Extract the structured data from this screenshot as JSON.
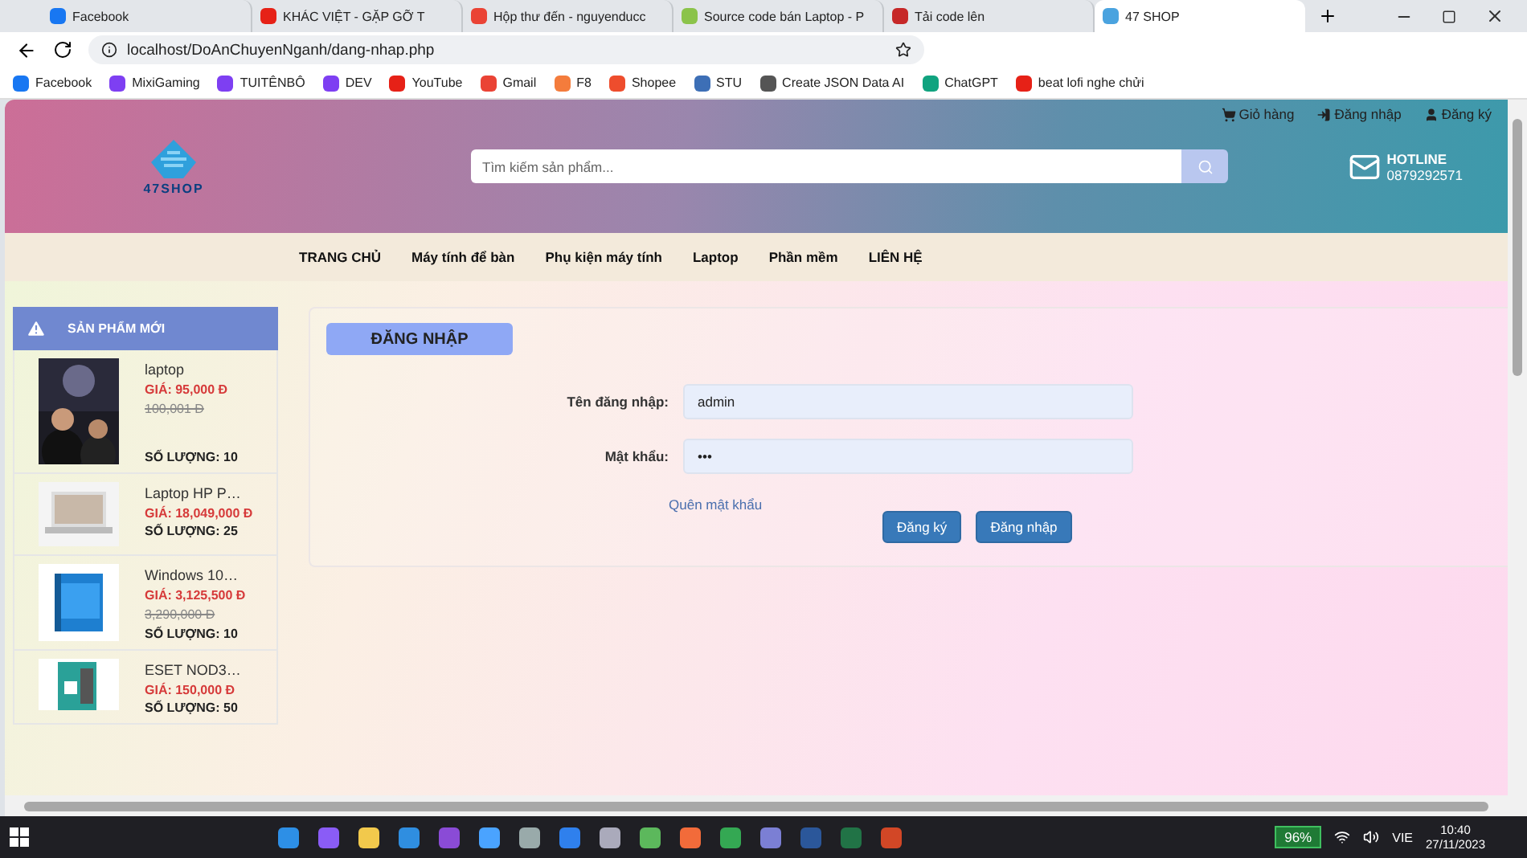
{
  "browser": {
    "tabs": [
      {
        "title": "Facebook",
        "selected": false
      },
      {
        "title": "KHÁC VIỆT - GẶP GỠ T",
        "selected": false
      },
      {
        "title": "Hộp thư đến - nguyenducc",
        "selected": false
      },
      {
        "title": "Source code bán Laptop - P",
        "selected": false
      },
      {
        "title": "Tải code lên",
        "selected": false
      },
      {
        "title": "47 SHOP",
        "selected": true
      }
    ],
    "address": "localhost/DoAnChuyenNganh/dang-nhap.php",
    "bookmarks": [
      "Facebook",
      "MixiGaming",
      "TUITÊNBÔ",
      "DEV",
      "YouTube",
      "Gmail",
      "F8",
      "Shopee",
      "STU",
      "Create JSON Data AI",
      "ChatGPT",
      "beat lofi nghe chửi"
    ]
  },
  "header": {
    "top_links": [
      "Giỏ hàng",
      "Đăng nhập",
      "Đăng ký"
    ],
    "logo": "47SHOP",
    "search": {
      "placeholder": "Tìm kiếm sản phẩm..."
    },
    "hotline_label": "HOTLINE",
    "hotline": "0879292571"
  },
  "nav": [
    "TRANG CHỦ",
    "Máy tính để bàn",
    "Phụ kiện máy tính",
    "Laptop",
    "Phần mềm",
    "LIÊN HỆ"
  ],
  "sidebar": {
    "title": "SẢN PHẨM MỚI",
    "products": [
      {
        "name": "laptop",
        "price": "GIÁ: 95,000 Đ",
        "old_price": "100,001 Đ",
        "quantity": "SỐ LƯỢNG: 10"
      },
      {
        "name": "Laptop HP P…",
        "price": "GIÁ: 18,049,000 Đ",
        "quantity": "SỐ LƯỢNG: 25"
      },
      {
        "name": "Windows 10…",
        "price": "GIÁ: 3,125,500 Đ",
        "old_price": "3,290,000 Đ",
        "quantity": "SỐ LƯỢNG: 10"
      },
      {
        "name": "ESET NOD3…",
        "price": "GIÁ: 150,000 Đ",
        "quantity": "SỐ LƯỢNG: 50"
      }
    ]
  },
  "login": {
    "title": "ĐĂNG NHẬP",
    "fields": [
      {
        "label": "Tên đăng nhập:",
        "value": "admin"
      },
      {
        "label": "Mật khẩu:",
        "value": "•••"
      }
    ],
    "forgot": "Quên mật khẩu",
    "buttons": [
      "Đăng ký",
      "Đăng nhập"
    ]
  },
  "taskbar": {
    "battery": "96%",
    "language": "VIE",
    "time": "10:40",
    "date": "27/11/2023"
  }
}
